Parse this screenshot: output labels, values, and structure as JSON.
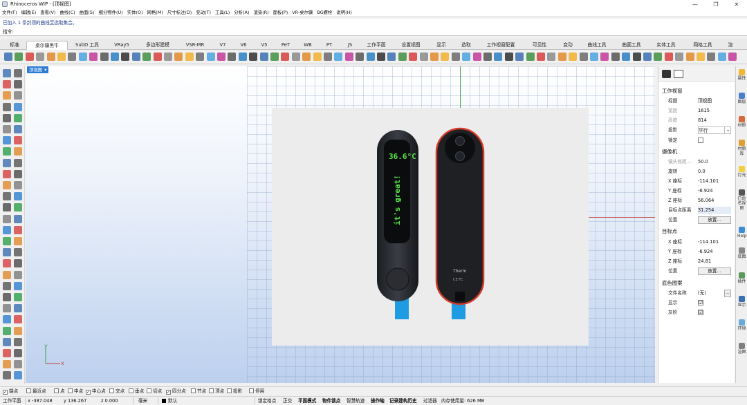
{
  "window": {
    "title": "Rhinoceros WIP - [顶视图]",
    "min": "—",
    "max": "❐",
    "close": "✕"
  },
  "menu": [
    "文件(F)",
    "编辑(E)",
    "查看(V)",
    "曲线(C)",
    "曲面(S)",
    "细分物件(U)",
    "实体(O)",
    "网格(M)",
    "尺寸标注(D)",
    "变动(T)",
    "工具(L)",
    "分析(A)",
    "渲染(R)",
    "面板(P)",
    "VR-桌尔骥",
    "BG螺栓",
    "说明(H)"
  ],
  "command": {
    "history": "已加入 1 条封闭的曲线至选取集合。",
    "prompt": "指令:"
  },
  "tabs": [
    "标准",
    "桌尔骥黑牛",
    "SubD 工具",
    "VRay5",
    "多边形建模",
    "VSR-MR",
    "V7",
    "V6",
    "V5",
    "PeT",
    "WB",
    "PT",
    "JS",
    "工作平面",
    "设置视图",
    "显示",
    "选取",
    "工作视窗配置",
    "可见性",
    "变动",
    "曲线工具",
    "曲面工具",
    "实体工具",
    "网格工具",
    "渲"
  ],
  "viewport": {
    "label": "顶视图",
    "axis_x": "x",
    "axis_y": "y"
  },
  "props": {
    "section_viewport": "工作视窗",
    "title_k": "标题",
    "title_v": "顶视图",
    "width_k": "宽度",
    "width_v": "1615",
    "height_k": "高度",
    "height_v": "814",
    "proj_k": "投影",
    "proj_v": "平行",
    "lock_k": "锁定",
    "section_camera": "摄像机",
    "lens_k": "镜头焦距...",
    "lens_v": "50.0",
    "rot_k": "旋转",
    "rot_v": "0.0",
    "cx_k": "X 座标",
    "cx_v": "-114.101",
    "cy_k": "Y 座标",
    "cy_v": "-6.924",
    "cz_k": "Z 座标",
    "cz_v": "56.064",
    "dist_k": "目标点距离",
    "dist_v": "31.254",
    "pos_k": "位置",
    "place_btn": "放置...",
    "section_target": "目标点",
    "tx_k": "X 座标",
    "tx_v": "-114.101",
    "ty_k": "Y 座标",
    "ty_v": "-6.924",
    "tz_k": "Z 座标",
    "tz_v": "24.81",
    "tpos_k": "位置",
    "tplace_btn": "放置...",
    "section_bg": "底色图案",
    "file_k": "文件名称",
    "file_v": "(无)",
    "file_btn": "...",
    "show_k": "显示",
    "gray_k": "灰阶",
    "check": "☑"
  },
  "vtabs": [
    "属性",
    "图层",
    "材质",
    "材质库",
    "灯光",
    "已命名视图",
    "Help",
    "底图",
    "插件",
    "显示",
    "环境",
    "渲图"
  ],
  "osnap": [
    {
      "label": "端点",
      "checked": true
    },
    {
      "label": "最近点",
      "checked": false
    },
    {
      "label": "点",
      "checked": false
    },
    {
      "label": "中点",
      "checked": false
    },
    {
      "label": "中心点",
      "checked": true
    },
    {
      "label": "交点",
      "checked": false
    },
    {
      "label": "垂点",
      "checked": false
    },
    {
      "label": "切点",
      "checked": false
    },
    {
      "label": "四分点",
      "checked": true
    },
    {
      "label": "节点",
      "checked": false
    },
    {
      "label": "顶点",
      "checked": false
    },
    {
      "label": "投影",
      "checked": false
    },
    {
      "label": "停用",
      "checked": false
    }
  ],
  "status": {
    "cplane": "工作平面",
    "x": "x -387.048",
    "y": "y 136.267",
    "z": "z 0.000",
    "unit": "毫米",
    "layer": "默认",
    "toggles": [
      "锁定格点",
      "正交",
      "平面模式",
      "物件锁点",
      "智慧轨迹",
      "操作轴",
      "记录建构历史",
      "过滤器"
    ],
    "memory": "内存使用量: 626 MB"
  },
  "image": {
    "temp": "36.6°C",
    "message": "it's great!",
    "brand": "Therm",
    "cert": "CE FC"
  }
}
